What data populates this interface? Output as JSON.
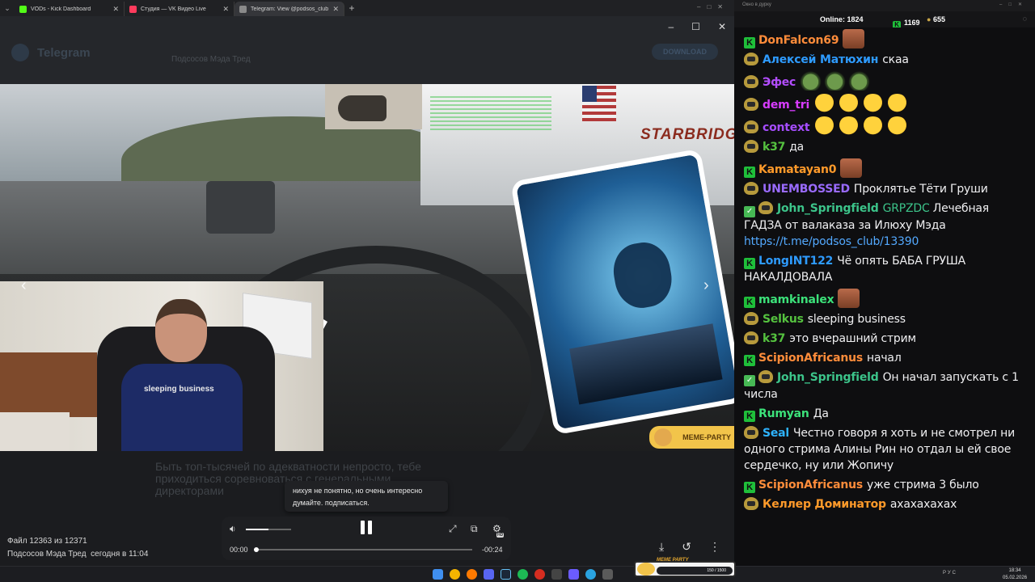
{
  "browser": {
    "tabs": [
      {
        "title": "VODs - Kick Dashboard",
        "color": "#53fc18",
        "active": false
      },
      {
        "title": "Студия — VK Видео Live",
        "color": "#ff3b5c",
        "active": false
      },
      {
        "title": "Telegram: View @podsos_club",
        "color": "#8a8a8a",
        "active": true
      }
    ],
    "new_tab": "+"
  },
  "telegram": {
    "brand": "Telegram",
    "channel": "Подсосов Мэда Тред",
    "download_label": "DOWNLOAD",
    "background_text": "Быть топ-тысячей по адекватности непросто, тебе приходиться соревноваться с генеральными директорами"
  },
  "video": {
    "truck_text": "STARBRIDGE",
    "shirt_text": "sleeping business",
    "watermark": "MEME-PARTY",
    "prev_icon": "chevron-left-icon",
    "next_icon": "chevron-right-icon"
  },
  "tooltip": {
    "line1": "нихуя не понятно, но очень интересно",
    "line2": "думайте. подписаться."
  },
  "player": {
    "time_current": "00:00",
    "time_remaining": "-00:24",
    "volume": 0.5,
    "progress": 0.0,
    "hd_label": "HD"
  },
  "file_info": {
    "counter": "Файл 12363 из 12371",
    "author": "Подсосов Мэда Тред",
    "date": "сегодня в 11:04"
  },
  "chat_window": {
    "title": "Окно в дурку",
    "online_label": "Online:",
    "online_count": "1824",
    "kick_count": "1169",
    "twitch_count": "655"
  },
  "chat": [
    {
      "badges": [
        "k"
      ],
      "nick": "DonFalcon69",
      "color": "#ff8c3a",
      "text": "",
      "emotes": [
        "face"
      ]
    },
    {
      "badges": [
        "t"
      ],
      "nick": "Алексей Матюхин",
      "color": "#2e9bff",
      "text": "скаа",
      "emotes": []
    },
    {
      "badges": [
        "t"
      ],
      "nick": "Эфес",
      "color": "#b34dff",
      "text": "",
      "emotes": [
        "pepe",
        "pepe",
        "pepe"
      ]
    },
    {
      "badges": [
        "t"
      ],
      "nick": "dem_tri",
      "color": "#d83cff",
      "text": "",
      "emotes": [
        "laugh",
        "laugh",
        "laugh",
        "laugh"
      ]
    },
    {
      "badges": [
        "t"
      ],
      "nick": "context",
      "color": "#a64dff",
      "text": "",
      "emotes": [
        "laugh",
        "laugh",
        "laugh",
        "laugh"
      ]
    },
    {
      "badges": [
        "t"
      ],
      "nick": "k37",
      "color": "#55c23f",
      "text": "да",
      "emotes": []
    },
    {
      "badges": [
        "k"
      ],
      "nick": "Kamatayan0",
      "color": "#ff9a2a",
      "text": "",
      "emotes": [
        "face"
      ]
    },
    {
      "badges": [
        "t"
      ],
      "nick": "UNEMBOSSED",
      "color": "#9a6bff",
      "text": "Проклятье Тёти Груши",
      "emotes": []
    },
    {
      "badges": [
        "chk",
        "t"
      ],
      "nick": "John_Springfield",
      "color": "#3cc48a",
      "text": "GRPZDC",
      "text_color": "#3cc48a",
      "text2": "Лечебная ГАДЗА от валаказа за Илюху Мэда",
      "link": "https://t.me/podsos_club/13390",
      "emotes": []
    },
    {
      "badges": [
        "k"
      ],
      "nick": "LongINT122",
      "color": "#2e9bff",
      "text": "Чё опять БАБА ГРУША НАКАЛДОВАЛА",
      "emotes": []
    },
    {
      "badges": [
        "k"
      ],
      "nick": "mamkinalex",
      "color": "#3ce27a",
      "text": "",
      "emotes": [
        "face"
      ]
    },
    {
      "badges": [
        "t"
      ],
      "nick": "Selkus",
      "color": "#55c23f",
      "text": "sleeping business",
      "emotes": []
    },
    {
      "badges": [
        "t"
      ],
      "nick": "k37",
      "color": "#55c23f",
      "text": "это вчерашний стрим",
      "emotes": []
    },
    {
      "badges": [
        "k"
      ],
      "nick": "ScipionAfricanus",
      "color": "#ff8c3a",
      "text": "начал",
      "emotes": []
    },
    {
      "badges": [
        "chk",
        "t"
      ],
      "nick": "John_Springfield",
      "color": "#3cc48a",
      "text": "Он начал запускать с 1 числа",
      "emotes": []
    },
    {
      "badges": [
        "k"
      ],
      "nick": "Rumyan",
      "color": "#3ce27a",
      "text": "Да",
      "emotes": []
    },
    {
      "badges": [
        "t"
      ],
      "nick": "Seal",
      "color": "#2eb3ff",
      "text": "Честно говоря я хоть и не смотрел ни одного стрима Алины Рин но отдал ы ей свое сердечко, ну или Жопичу",
      "emotes": []
    },
    {
      "badges": [
        "k"
      ],
      "nick": "ScipionAfricanus",
      "color": "#ff8c3a",
      "text": "уже стрима 3 было",
      "emotes": []
    },
    {
      "badges": [
        "t"
      ],
      "nick": "Келлер Доминатор",
      "color": "#ff9a2a",
      "text": "ахахахахах",
      "emotes": []
    }
  ],
  "taskbar": {
    "meme_party_name": "MEME PARTY",
    "meme_party_counter": "150 / 1500",
    "lang": "РУС",
    "time": "18:34",
    "date": "05.02.2026"
  }
}
